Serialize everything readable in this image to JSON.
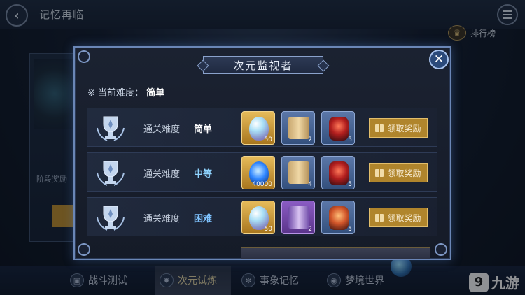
{
  "header": {
    "title": "记忆再临",
    "back_icon": "back-arrow-icon",
    "menu_icon": "hamburger-menu-icon"
  },
  "ranking": {
    "label": "排行榜",
    "icon": "crown-icon"
  },
  "background_stage": {
    "label": "阶段奖励"
  },
  "bottom_tabs": [
    {
      "label": "战斗测试",
      "icon": "cube-icon",
      "active": false
    },
    {
      "label": "次元试炼",
      "icon": "star-burst-icon",
      "active": true
    },
    {
      "label": "事象记忆",
      "icon": "spiral-icon",
      "active": false
    },
    {
      "label": "梦境世界",
      "icon": "eye-icon",
      "active": false
    }
  ],
  "watermark": {
    "text": "九游"
  },
  "modal": {
    "title": "次元监视者",
    "current_difficulty_label": "※ 当前难度：",
    "current_difficulty_value": "简单",
    "rows": [
      {
        "label": "通关难度",
        "level": "简单",
        "items": [
          {
            "icon": "crystal-icon",
            "count": "50",
            "rarity": "gold"
          },
          {
            "icon": "scroll-icon",
            "count": "2",
            "rarity": "blue"
          },
          {
            "icon": "red-core-icon",
            "count": "5",
            "rarity": "blue"
          }
        ],
        "button": "领取奖励"
      },
      {
        "label": "通关难度",
        "level": "中等",
        "items": [
          {
            "icon": "blue-flame-icon",
            "count": "40000",
            "rarity": "gold"
          },
          {
            "icon": "scroll-icon",
            "count": "4",
            "rarity": "blue"
          },
          {
            "icon": "red-core-icon",
            "count": "5",
            "rarity": "blue"
          }
        ],
        "button": "领取奖励"
      },
      {
        "label": "通关难度",
        "level": "困难",
        "items": [
          {
            "icon": "crystal-icon",
            "count": "50",
            "rarity": "gold"
          },
          {
            "icon": "purple-scroll-icon",
            "count": "2",
            "rarity": "purple"
          },
          {
            "icon": "orange-core-icon",
            "count": "5",
            "rarity": "blue"
          }
        ],
        "button": "领取奖励"
      }
    ]
  },
  "colors": {
    "claim_button": "#b0852c",
    "frame": "#6a86b6",
    "accent_blue": "#8fd4ff"
  }
}
